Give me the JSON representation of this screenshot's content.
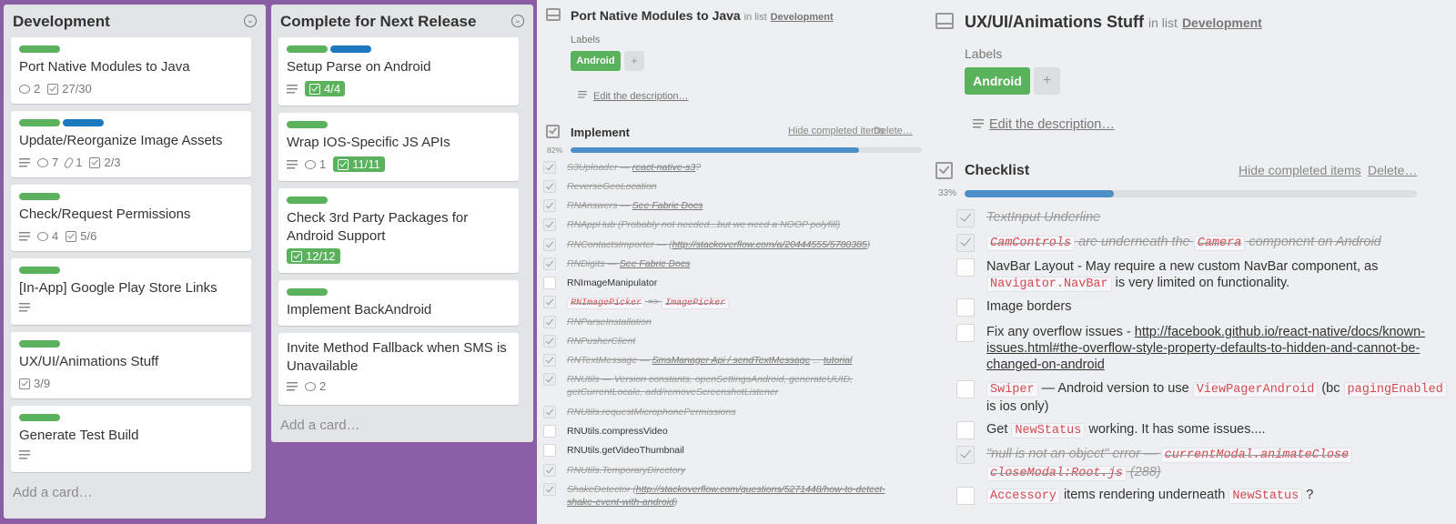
{
  "lists": [
    {
      "title": "Development",
      "cards": [
        {
          "title": "Port Native Modules to Java",
          "comments": "2",
          "checklist": "27/30"
        },
        {
          "title": "Update/Reorganize Image Assets",
          "comments": "7",
          "attachments": "1",
          "checklist": "2/3"
        },
        {
          "title": "Check/Request Permissions",
          "comments": "4",
          "checklist": "5/6"
        },
        {
          "title": "[In-App] Google Play Store Links"
        },
        {
          "title": "UX/UI/Animations Stuff",
          "checklist": "3/9"
        },
        {
          "title": "Generate Test Build"
        }
      ],
      "add_card": "Add a card…"
    },
    {
      "title": "Complete for Next Release",
      "cards": [
        {
          "title": "Setup Parse on Android",
          "checklist": "4/4"
        },
        {
          "title": "Wrap IOS-Specific JS APIs",
          "comments": "1",
          "checklist": "11/11"
        },
        {
          "title": "Check 3rd Party Packages for Android Support",
          "checklist": "12/12"
        },
        {
          "title": "Implement BackAndroid"
        },
        {
          "title": "Invite Method Fallback when SMS is Unavailable",
          "comments": "2"
        }
      ],
      "add_card": "Add a card…"
    }
  ],
  "colors": {
    "label_green": "#5ab35c",
    "label_blue": "#1b79c0",
    "board_bg": "#8a5ea4",
    "progress": "#4d8ec9"
  },
  "detail1": {
    "title": "Port Native Modules to Java",
    "in_list": "in list",
    "list_name": "Development",
    "labels_heading": "Labels",
    "label": "Android",
    "plus": "+",
    "edit_description": "Edit the description…",
    "checklist_title": "Implement",
    "hide_completed": "Hide completed items",
    "delete": "Delete…",
    "percent_label": "82%",
    "percent": 82,
    "items": [
      {
        "done": true,
        "html": "S3Uploader — <a>react-native-s3</a>?"
      },
      {
        "done": true,
        "html": "ReverseGeoLocation"
      },
      {
        "done": true,
        "html": "RNAnswers — <a>See Fabric Docs</a>"
      },
      {
        "done": true,
        "html": "RNAppHub (Probably not needed...but we need a NOOP polyfill)"
      },
      {
        "done": true,
        "html": "RNContactsImporter — (<a>http://stackoverflow.com/a/20444555/5780385</a>)"
      },
      {
        "done": true,
        "html": "RNDigits — <a>See Fabric Docs</a>"
      },
      {
        "done": false,
        "html": "RNImageManipulator"
      },
      {
        "done": true,
        "html": "<code>RNImagePicker</code> =&gt; <code>ImagePicker</code>"
      },
      {
        "done": true,
        "html": "RNParseInstallation"
      },
      {
        "done": true,
        "html": "RNPusherClient"
      },
      {
        "done": true,
        "html": "RNTextMessage — <a>SmsManager Api / sendTextMessage</a> ... <a>tutorial</a>"
      },
      {
        "done": true,
        "html": "RNUtils — Version constants, openSettingsAndroid, generateUUID, getCurrentLocale, add/removeScreenshotListener"
      },
      {
        "done": true,
        "html": "RNUtils.requestMicrophonePermissions"
      },
      {
        "done": false,
        "html": "RNUtils.compressVideo"
      },
      {
        "done": false,
        "html": "RNUtils.getVideoThumbnail"
      },
      {
        "done": true,
        "html": "RNUtils.TemporaryDirectory"
      },
      {
        "done": true,
        "html": "ShakeDetector (<a>http://stackoverflow.com/questions/5271448/how-to-detect-shake-event-with-android</a>)"
      }
    ]
  },
  "detail2": {
    "title": "UX/UI/Animations Stuff",
    "in_list": "in list",
    "list_name": "Development",
    "labels_heading": "Labels",
    "label": "Android",
    "plus": "+",
    "edit_description": "Edit the description…",
    "checklist_title": "Checklist",
    "hide_completed": "Hide completed items",
    "delete": "Delete…",
    "percent_label": "33%",
    "percent": 33,
    "items": [
      {
        "done": true,
        "html": "TextInput Underline"
      },
      {
        "done": true,
        "html": "<code>CamControls</code> are underneath the <code>Camera</code> component on Android"
      },
      {
        "done": false,
        "html": "NavBar Layout - May require a new custom NavBar component, as <code>Navigator.NavBar</code> is very limited on functionality."
      },
      {
        "done": false,
        "html": "Image borders"
      },
      {
        "done": false,
        "html": "Fix any overflow issues - <a>http://facebook.github.io/react-native/docs/known-issues.html#the-overflow-style-property-defaults-to-hidden-and-cannot-be-changed-on-android</a>"
      },
      {
        "done": false,
        "html": "<code>Swiper</code> — Android version to use <code>ViewPagerAndroid</code> (bc <code>pagingEnabled</code> is ios only)"
      },
      {
        "done": false,
        "html": "Get <code>NewStatus</code> working. It has some issues...."
      },
      {
        "done": true,
        "html": "\"null is not an object\" error — <code>currentModal.animateClose</code> <code>closeModal:Root.js</code> (288)"
      },
      {
        "done": false,
        "html": "<code>Accessory</code> items rendering underneath <code>NewStatus</code> ?"
      }
    ]
  }
}
